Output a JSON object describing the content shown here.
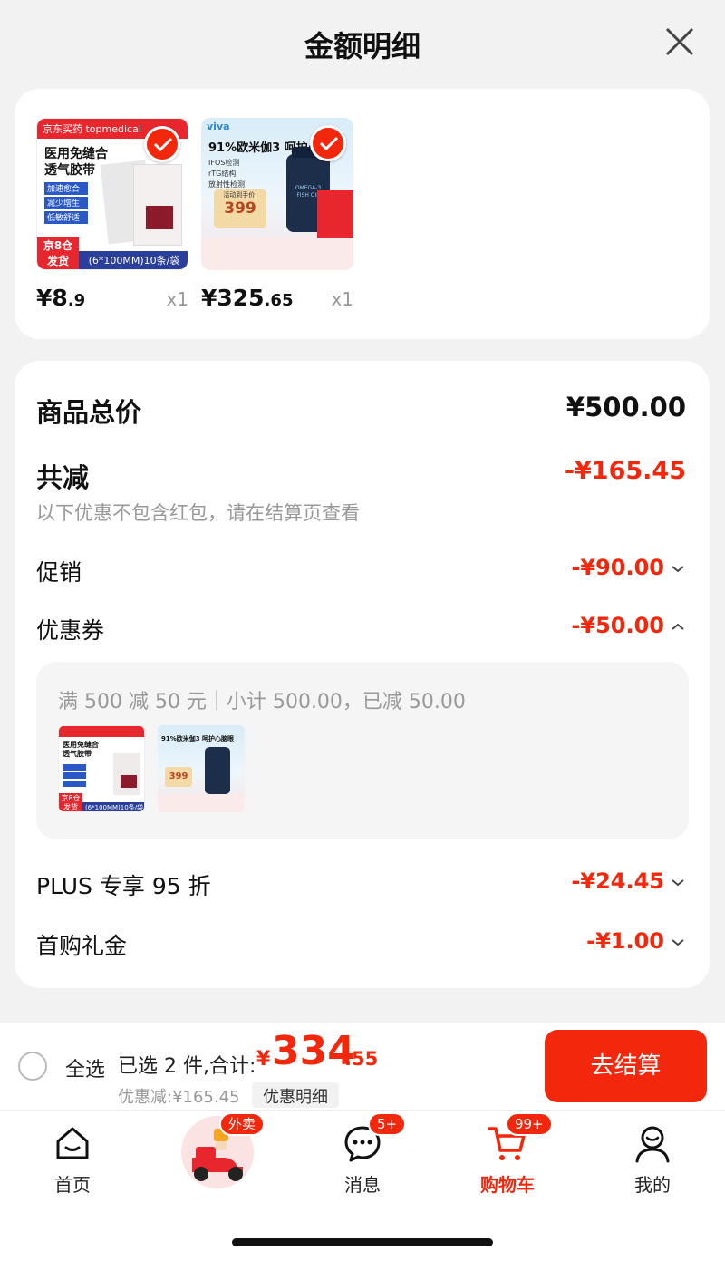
{
  "header": {
    "title": "金额明细"
  },
  "products": [
    {
      "brand": "京东买药 topmedical",
      "name": "医用免缝合透气胶带",
      "features": [
        "加速愈合",
        "减少增生",
        "低敏舒适"
      ],
      "tag": "京8仓发货",
      "spec": "(6*100MM)10条/袋",
      "price_int": "¥8",
      "price_dec": ".9",
      "qty": "x1"
    },
    {
      "brand": "viva",
      "name": "91%欧米伽3 呵护心",
      "features": [
        "IFOS检测",
        "rTG结构",
        "放射性检测"
      ],
      "promo_label": "活动到手价:",
      "promo_price": "399",
      "bottle_text": "OMEGA-3 FISH OIL",
      "price_int": "¥325",
      "price_dec": ".65",
      "qty": "x1"
    }
  ],
  "summary": {
    "total_label": "商品总价",
    "total_value": "¥500.00",
    "reduce_label": "共减",
    "reduce_value": "-¥165.45",
    "note": "以下优惠不包含红包，请在结算页查看",
    "items": [
      {
        "label": "促销",
        "value": "-¥90.00",
        "expanded": false
      },
      {
        "label": "优惠券",
        "value": "-¥50.00",
        "expanded": true
      },
      {
        "label": "PLUS 专享 95 折",
        "value": "-¥24.45",
        "expanded": false
      },
      {
        "label": "首购礼金",
        "value": "-¥1.00",
        "expanded": false
      }
    ],
    "coupon_detail": "满 500 减 50 元｜小计 500.00，已减 50.00",
    "coupon_thumbs": [
      {
        "name": "医用免缝合透气胶带",
        "tag": "京8仓发货",
        "spec": "(6*100MM)10条/袋"
      },
      {
        "name": "91%欧米伽3 呵护心脑眼",
        "promo_price": "399"
      }
    ]
  },
  "bottom": {
    "select_all": "全选",
    "selected_prefix": "已选 2 件,合计:",
    "currency": "¥",
    "total_int": "334",
    "total_dec": ".55",
    "discount_text": "优惠减:¥165.45",
    "detail_link": "优惠明细",
    "checkout": "去结算"
  },
  "tabs": [
    {
      "label": "首页",
      "icon": "home-icon",
      "badge": ""
    },
    {
      "label": "",
      "icon": "delivery-scooter-icon",
      "badge": "外卖"
    },
    {
      "label": "消息",
      "icon": "message-icon",
      "badge": "5+"
    },
    {
      "label": "购物车",
      "icon": "cart-icon",
      "badge": "99+",
      "active": true
    },
    {
      "label": "我的",
      "icon": "profile-icon",
      "badge": ""
    }
  ],
  "colors": {
    "accent": "#f2270c",
    "muted": "#999999",
    "background": "#f2f2f2"
  }
}
